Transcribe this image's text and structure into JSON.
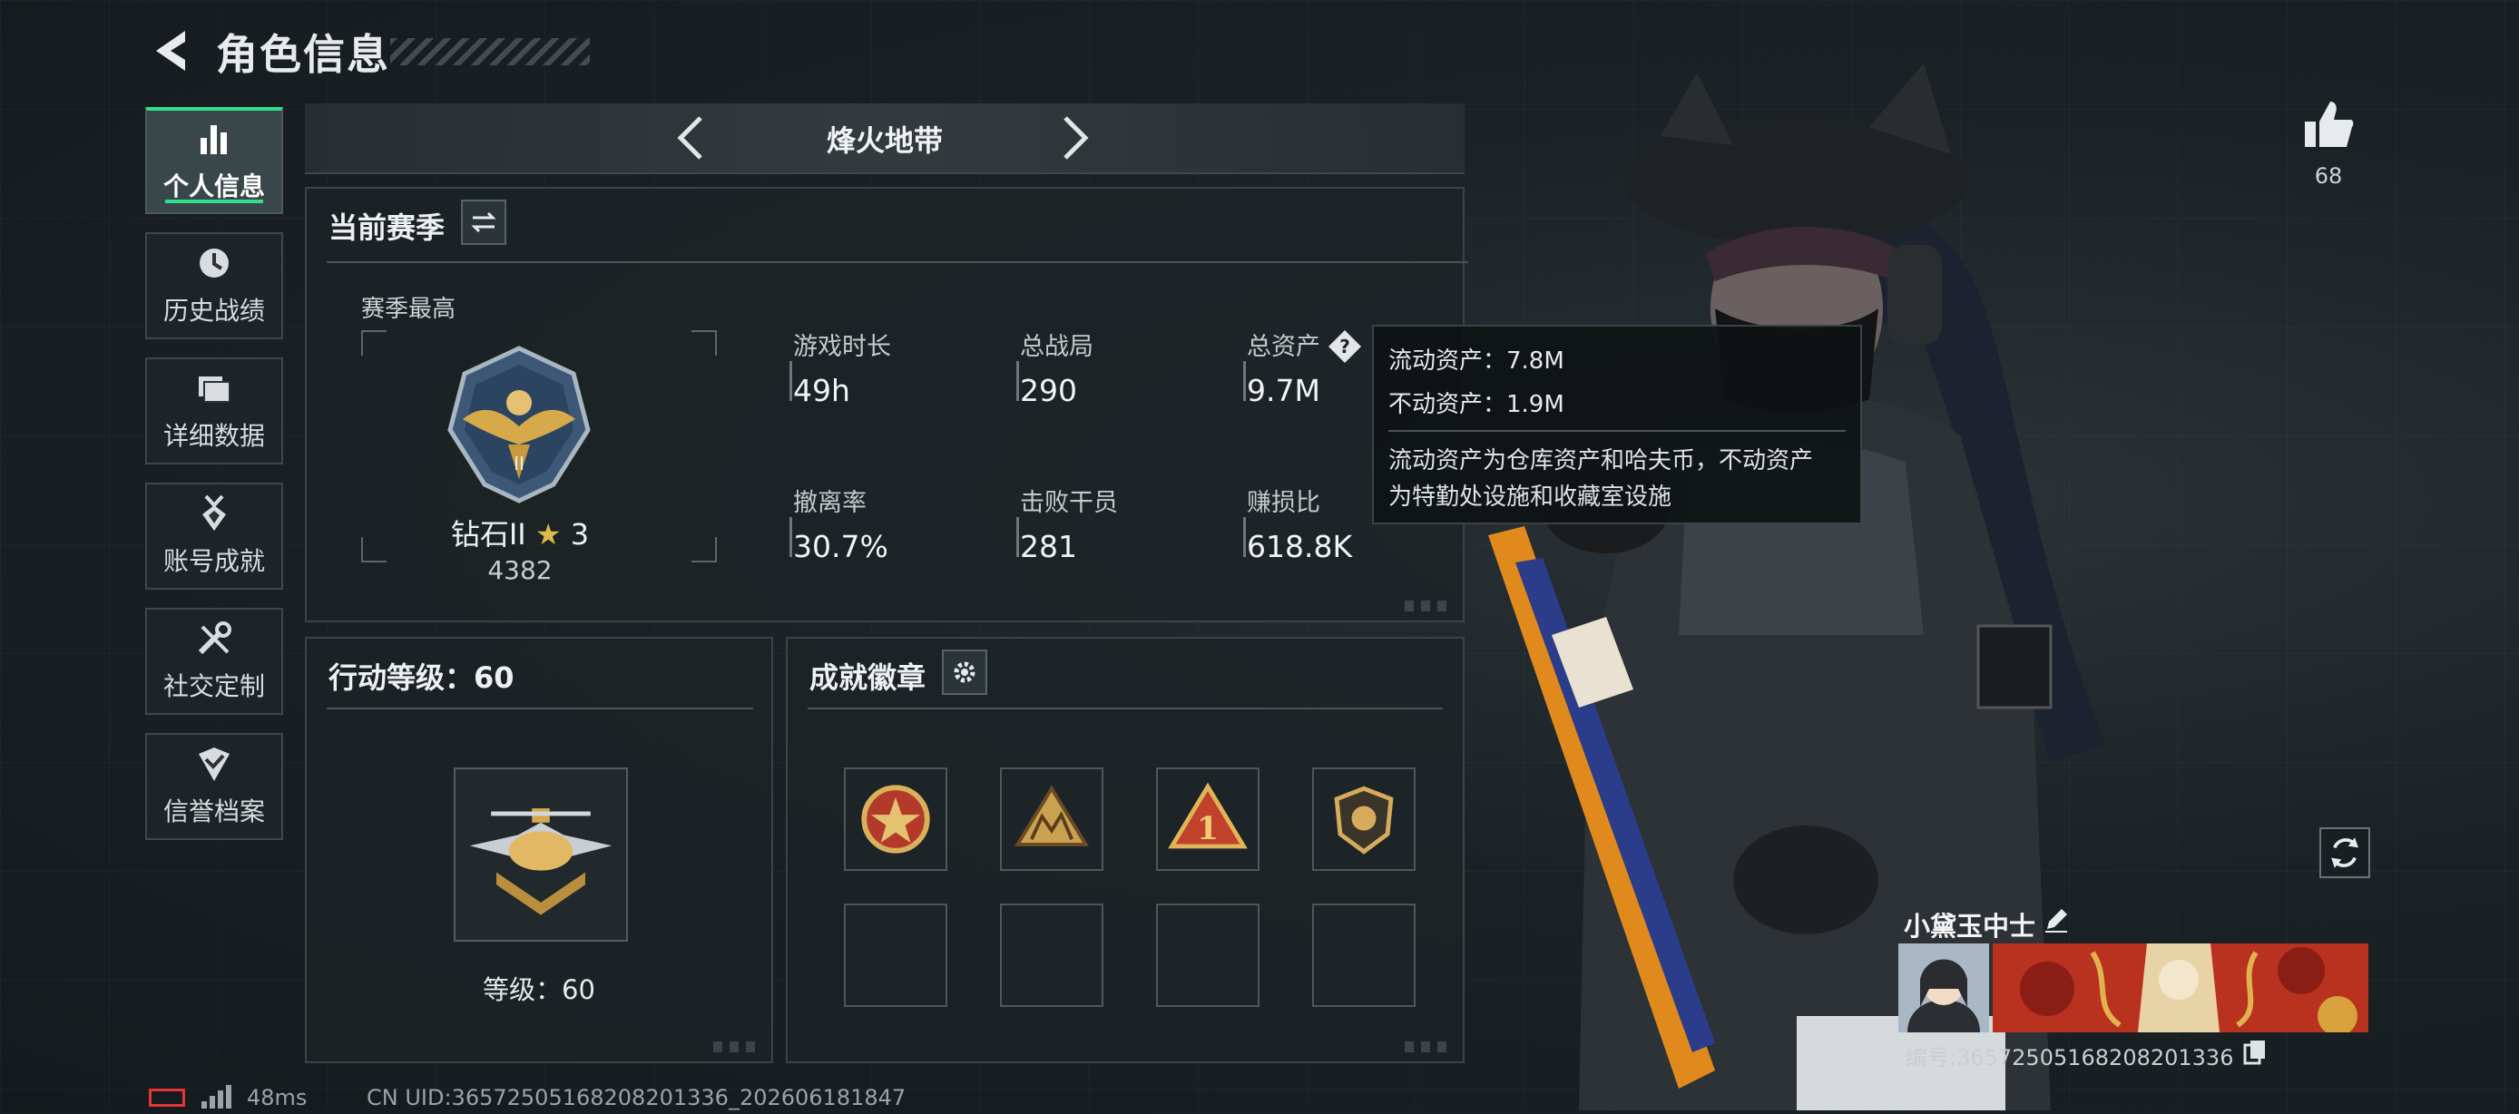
{
  "header": {
    "title": "角色信息"
  },
  "sidebar": {
    "items": [
      {
        "label": "个人信息",
        "icon": "bar-chart-icon",
        "active": true
      },
      {
        "label": "历史战绩",
        "icon": "clock-icon"
      },
      {
        "label": "详细数据",
        "icon": "folder-icon"
      },
      {
        "label": "账号成就",
        "icon": "medal-icon"
      },
      {
        "label": "社交定制",
        "icon": "tools-icon"
      },
      {
        "label": "信誉档案",
        "icon": "shield-check-icon"
      }
    ]
  },
  "mode": {
    "name": "烽火地带"
  },
  "season": {
    "title": "当前赛季",
    "best_label": "赛季最高",
    "rank_name": "钻石II",
    "rank_stars": "3",
    "rank_score": "4382",
    "stats": [
      {
        "key": "游戏时长",
        "value": "49h"
      },
      {
        "key": "总战局",
        "value": "290"
      },
      {
        "key": "总资产",
        "value": "9.7M"
      },
      {
        "key": "撤离率",
        "value": "30.7%"
      },
      {
        "key": "击败干员",
        "value": "281"
      },
      {
        "key": "赚损比",
        "value": "618.8K"
      }
    ]
  },
  "tooltip": {
    "liquid": "流动资产：7.8M",
    "fixed": "不动资产：1.9M",
    "desc_line1": "流动资产为仓库资产和哈夫币，不动资产",
    "desc_line2": "为特勤处设施和收藏室设施"
  },
  "level": {
    "title": "行动等级：60",
    "text": "等级：60"
  },
  "badges": {
    "title": "成就徽章"
  },
  "likes": {
    "count": "68"
  },
  "player": {
    "name": "小黛玉中士",
    "id": "编号:3657250516820820133​6"
  },
  "footer": {
    "ping": "48ms",
    "uid": "CN UID:3657250516820820133​6_202606181847"
  },
  "colors": {
    "accent": "#2fe08a",
    "gold": "#e0b94a",
    "battery": "#e53535"
  }
}
